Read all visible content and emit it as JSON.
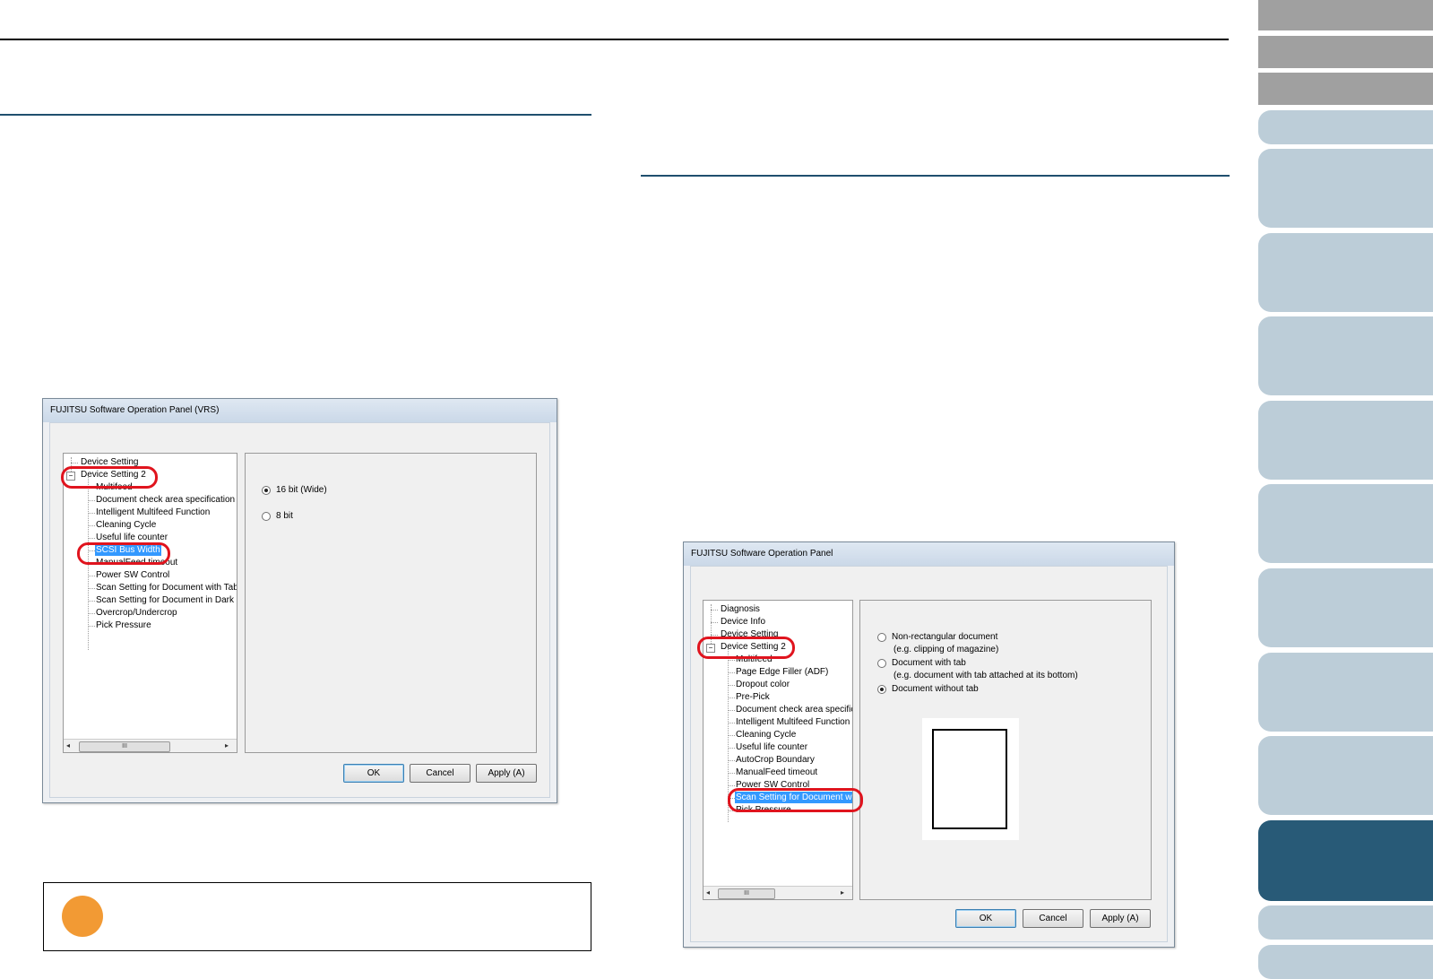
{
  "left_dialog": {
    "title": "FUJITSU Software Operation Panel (VRS)",
    "tree": [
      "Device Setting",
      "Device Setting 2",
      "Multifeed",
      "Document check area specification",
      "Intelligent Multifeed Function",
      "Cleaning Cycle",
      "Useful life counter",
      "SCSI Bus Width",
      "ManualFeed timeout",
      "Power SW Control",
      "Scan Setting for Document with Tab",
      "Scan Setting for Document in Dark B",
      "Overcrop/Undercrop",
      "Pick Pressure"
    ],
    "selected_item": "SCSI Bus Width",
    "options": [
      {
        "label": "16 bit (Wide)",
        "selected": true
      },
      {
        "label": "8 bit",
        "selected": false
      }
    ],
    "scroll_thumb": "III",
    "buttons": {
      "ok": "OK",
      "cancel": "Cancel",
      "apply": "Apply (A)"
    }
  },
  "right_dialog": {
    "title": "FUJITSU Software Operation Panel",
    "tree": [
      "Diagnosis",
      "Device Info",
      "Device Setting",
      "Device Setting 2",
      "Multifeed",
      "Page Edge Filler (ADF)",
      "Dropout color",
      "Pre-Pick",
      "Document check area specific",
      "Intelligent Multifeed Function",
      "Cleaning Cycle",
      "Useful life counter",
      "AutoCrop Boundary",
      "ManualFeed timeout",
      "Power SW Control",
      "Scan Setting for Document wit",
      "Pick Pressure"
    ],
    "selected_item": "Scan Setting for Document wit",
    "options": [
      {
        "label": "Non-rectangular document",
        "sub": "(e.g. clipping of magazine)",
        "selected": false
      },
      {
        "label": "Document with tab",
        "sub": "(e.g. document with tab attached at its bottom)",
        "selected": false
      },
      {
        "label": "Document without tab",
        "sub": "",
        "selected": true
      }
    ],
    "scroll_thumb": "III",
    "buttons": {
      "ok": "OK",
      "cancel": "Cancel",
      "apply": "Apply (A)"
    }
  },
  "colors": {
    "highlight": "#e0141e",
    "selection": "#3399ff",
    "tab_light": "#bccdd8",
    "tab_dark": "#285a77",
    "tab_gray": "#a0a0a0",
    "note_icon": "#f29a34"
  }
}
